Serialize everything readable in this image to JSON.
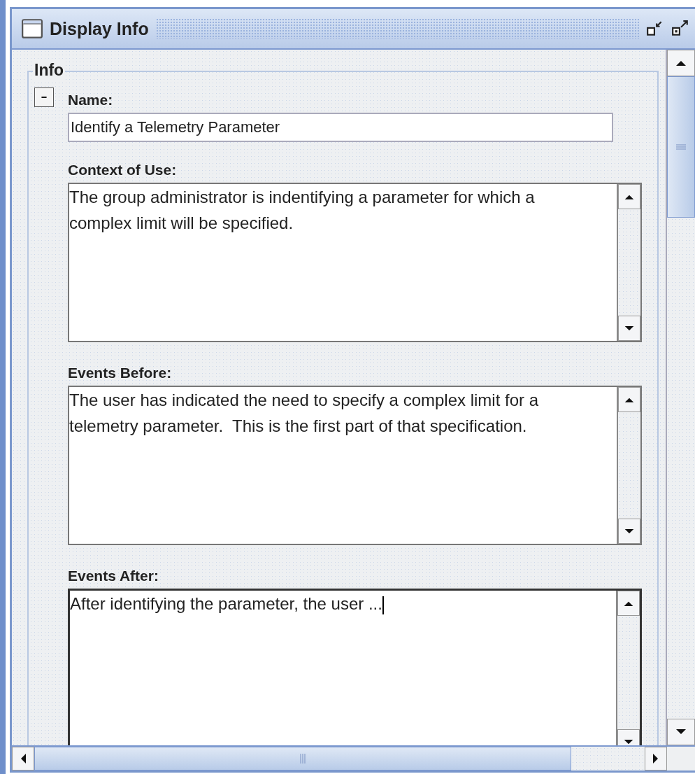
{
  "window": {
    "title": "Display Info"
  },
  "panel": {
    "title": "Info",
    "expanded": true
  },
  "fields": [
    {
      "kind": "line",
      "label": "Name:",
      "value": "Identify a Telemetry Parameter",
      "focused": false
    },
    {
      "kind": "area",
      "label": "Context of Use:",
      "value": "The group administrator is indentifying a parameter for which a complex limit will be specified.",
      "focused": false
    },
    {
      "kind": "area",
      "label": "Events Before:",
      "value": "The user has indicated the need to specify a complex limit for a telemetry parameter.  This is the first part of that specification.",
      "focused": false
    },
    {
      "kind": "area",
      "label": "Events After:",
      "value": "After identifying the parameter, the user ...",
      "focused": true
    }
  ]
}
